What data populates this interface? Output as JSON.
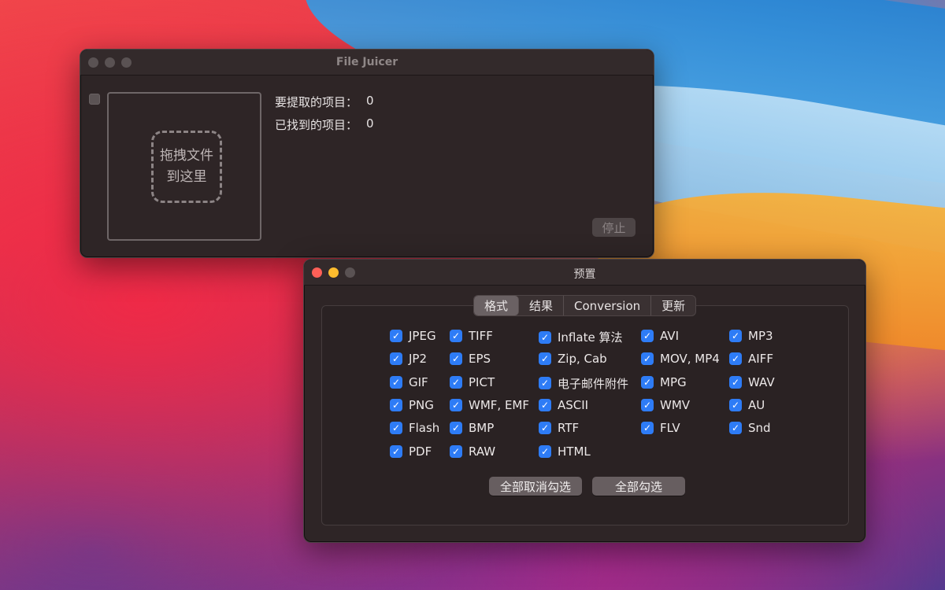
{
  "main_window": {
    "title": "File Juicer",
    "drop_line1": "拖拽文件",
    "drop_line2": "到这里",
    "items_to_extract_label": "要提取的项目：",
    "items_to_extract_value": "0",
    "items_found_label": "已找到的项目：",
    "items_found_value": "0",
    "stop_label": "停止"
  },
  "prefs_window": {
    "title": "预置",
    "tabs": [
      {
        "label": "格式",
        "active": true
      },
      {
        "label": "结果",
        "active": false
      },
      {
        "label": "Conversion",
        "active": false
      },
      {
        "label": "更新",
        "active": false
      }
    ],
    "columns": [
      [
        {
          "label": "JPEG",
          "checked": true
        },
        {
          "label": "JP2",
          "checked": true
        },
        {
          "label": "GIF",
          "checked": true
        },
        {
          "label": "PNG",
          "checked": true
        },
        {
          "label": "Flash",
          "checked": true
        },
        {
          "label": "PDF",
          "checked": true
        }
      ],
      [
        {
          "label": "TIFF",
          "checked": true
        },
        {
          "label": "EPS",
          "checked": true
        },
        {
          "label": "PICT",
          "checked": true
        },
        {
          "label": "WMF, EMF",
          "checked": true
        },
        {
          "label": "BMP",
          "checked": true
        },
        {
          "label": "RAW",
          "checked": true
        }
      ],
      [
        {
          "label": "Inflate 算法",
          "checked": true
        },
        {
          "label": "Zip, Cab",
          "checked": true
        },
        {
          "label": "电子邮件附件",
          "checked": true
        },
        {
          "label": "ASCII",
          "checked": true
        },
        {
          "label": "RTF",
          "checked": true
        },
        {
          "label": "HTML",
          "checked": true
        }
      ],
      [
        {
          "label": "AVI",
          "checked": true
        },
        {
          "label": "MOV, MP4",
          "checked": true
        },
        {
          "label": "MPG",
          "checked": true
        },
        {
          "label": "WMV",
          "checked": true
        },
        {
          "label": "FLV",
          "checked": true
        }
      ],
      [
        {
          "label": "MP3",
          "checked": true
        },
        {
          "label": "AIFF",
          "checked": true
        },
        {
          "label": "WAV",
          "checked": true
        },
        {
          "label": "AU",
          "checked": true
        },
        {
          "label": "Snd",
          "checked": true
        }
      ]
    ],
    "deselect_all_label": "全部取消勾选",
    "select_all_label": "全部勾选"
  },
  "colors": {
    "checkbox_accent": "#2e7cf6",
    "window_bg": "#2e2526",
    "close": "#fe5f57",
    "minimize": "#febc2e"
  }
}
